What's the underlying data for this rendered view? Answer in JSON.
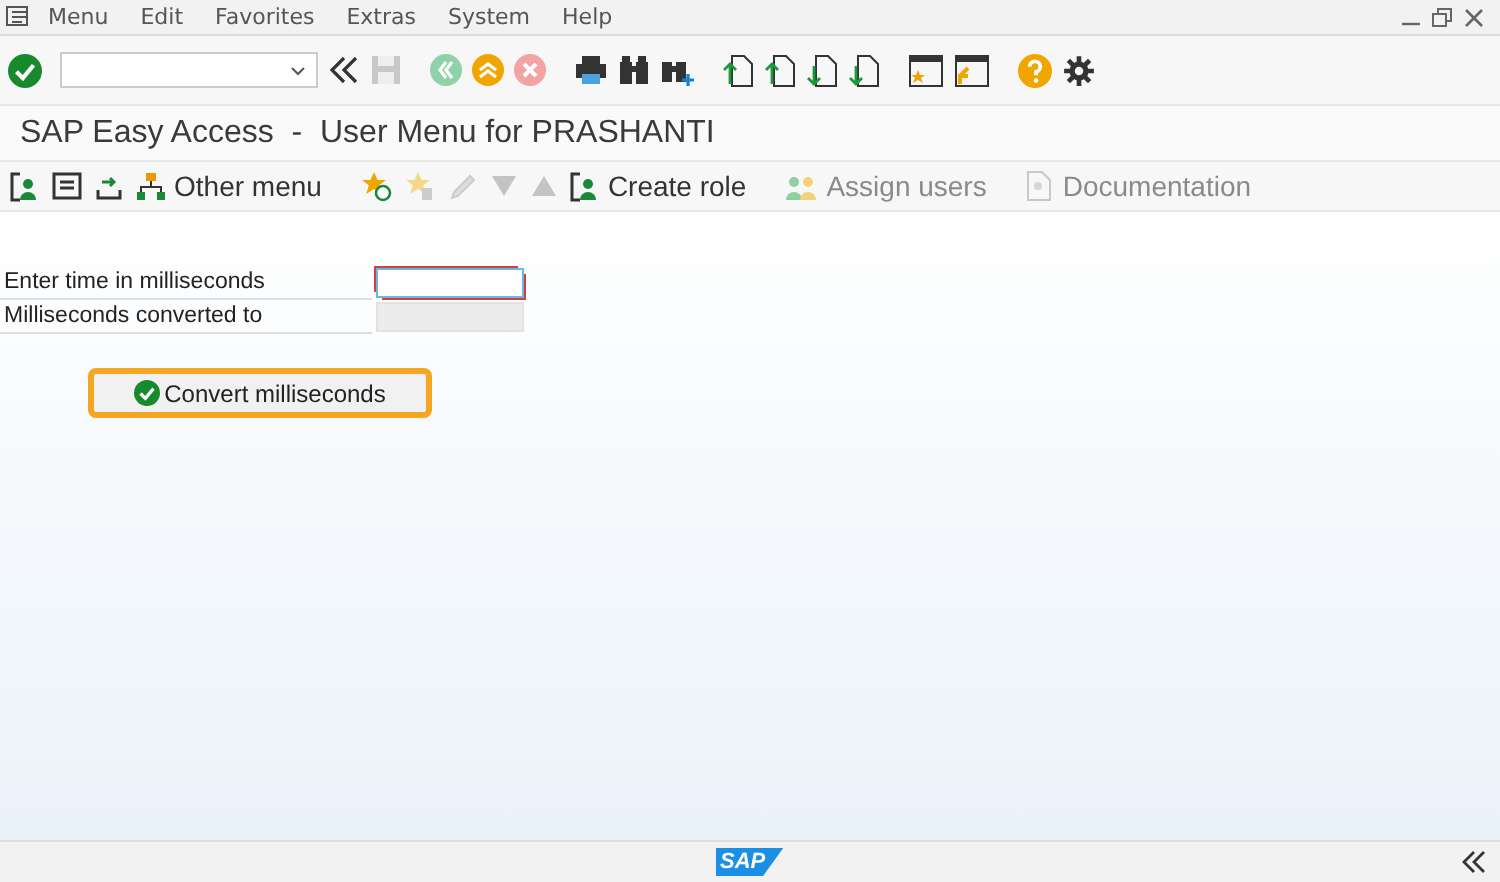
{
  "menu_bar": {
    "items": [
      "Menu",
      "Edit",
      "Favorites",
      "Extras",
      "System",
      "Help"
    ]
  },
  "title": "SAP Easy Access  -  User Menu for PRASHANTI",
  "app_toolbar": [
    {
      "label": "Other menu",
      "disabled": false
    },
    {
      "label": "Create role",
      "disabled": false
    },
    {
      "label": "Assign users",
      "disabled": true
    },
    {
      "label": "Documentation",
      "disabled": true
    }
  ],
  "form": {
    "rows": [
      {
        "label": "Enter time in milliseconds",
        "disabled": false,
        "focused": true
      },
      {
        "label": "Milliseconds converted to",
        "disabled": true,
        "focused": false
      }
    ],
    "button": {
      "label": "Convert milliseconds",
      "focused": true
    }
  },
  "footer": {
    "logo": "SAP"
  }
}
